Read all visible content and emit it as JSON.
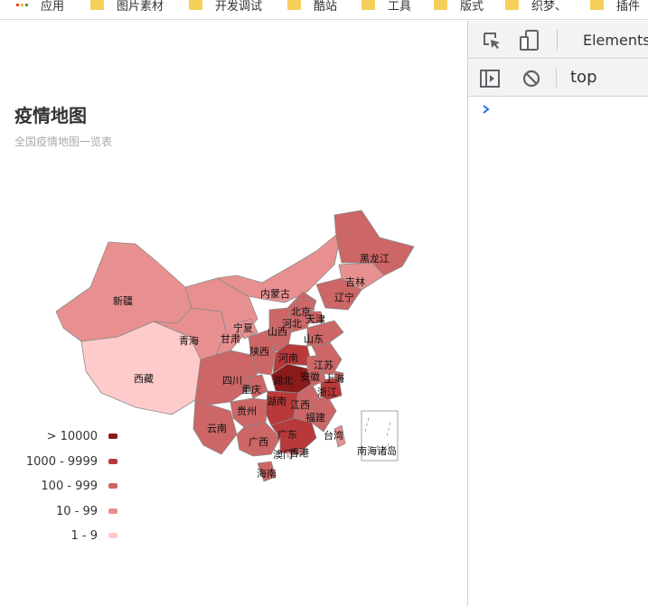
{
  "bookmarks": {
    "items": [
      {
        "label": "应用",
        "type": "apps"
      },
      {
        "label": "图片素材",
        "type": "folder"
      },
      {
        "label": "开发调试",
        "type": "folder"
      },
      {
        "label": "酷站",
        "type": "folder"
      },
      {
        "label": "工具",
        "type": "folder"
      },
      {
        "label": "版式",
        "type": "folder"
      },
      {
        "label": "织梦、",
        "type": "folder"
      },
      {
        "label": "插件",
        "type": "folder"
      }
    ]
  },
  "chart": {
    "title": "疫情地图",
    "subtitle": "全国疫情地图一览表"
  },
  "chart_data": {
    "type": "map",
    "legend": [
      {
        "label": "> 10000",
        "color": "#8b1a1a"
      },
      {
        "label": "1000 - 9999",
        "color": "#b8393a"
      },
      {
        "label": "100 - 999",
        "color": "#cd6666"
      },
      {
        "label": "10 - 99",
        "color": "#e89090"
      },
      {
        "label": "1 - 9",
        "color": "#ffcaca"
      }
    ],
    "regions": [
      {
        "name": "新疆",
        "band": "10 - 99"
      },
      {
        "name": "西藏",
        "band": "1 - 9"
      },
      {
        "name": "青海",
        "band": "10 - 99"
      },
      {
        "name": "甘肃",
        "band": "10 - 99"
      },
      {
        "name": "内蒙古",
        "band": "10 - 99"
      },
      {
        "name": "宁夏",
        "band": "10 - 99"
      },
      {
        "name": "陕西",
        "band": "100 - 999"
      },
      {
        "name": "山西",
        "band": "100 - 999"
      },
      {
        "name": "四川",
        "band": "100 - 999"
      },
      {
        "name": "重庆",
        "band": "100 - 999"
      },
      {
        "name": "云南",
        "band": "100 - 999"
      },
      {
        "name": "贵州",
        "band": "100 - 999"
      },
      {
        "name": "广西",
        "band": "100 - 999"
      },
      {
        "name": "湖北",
        "band": "> 10000"
      },
      {
        "name": "湖南",
        "band": "1000 - 9999"
      },
      {
        "name": "河南",
        "band": "1000 - 9999"
      },
      {
        "name": "江西",
        "band": "100 - 999"
      },
      {
        "name": "广东",
        "band": "1000 - 9999"
      },
      {
        "name": "福建",
        "band": "100 - 999"
      },
      {
        "name": "浙江",
        "band": "1000 - 9999"
      },
      {
        "name": "安徽",
        "band": "100 - 999"
      },
      {
        "name": "江苏",
        "band": "100 - 999"
      },
      {
        "name": "上海",
        "band": "100 - 999"
      },
      {
        "name": "山东",
        "band": "100 - 999"
      },
      {
        "name": "河北",
        "band": "100 - 999"
      },
      {
        "name": "北京",
        "band": "100 - 999"
      },
      {
        "name": "天津",
        "band": "100 - 999"
      },
      {
        "name": "辽宁",
        "band": "100 - 999"
      },
      {
        "name": "吉林",
        "band": "10 - 99"
      },
      {
        "name": "黑龙江",
        "band": "100 - 999"
      },
      {
        "name": "海南",
        "band": "100 - 999"
      },
      {
        "name": "台湾",
        "band": "10 - 99"
      },
      {
        "name": "香港",
        "band": "10 - 99"
      },
      {
        "name": "澳门",
        "band": "1 - 9"
      },
      {
        "name": "南海诸岛",
        "band": ""
      }
    ]
  },
  "devtools": {
    "tab_elements": "Elements",
    "context": "top",
    "colors": {
      "accent": "#1a73e8"
    }
  }
}
